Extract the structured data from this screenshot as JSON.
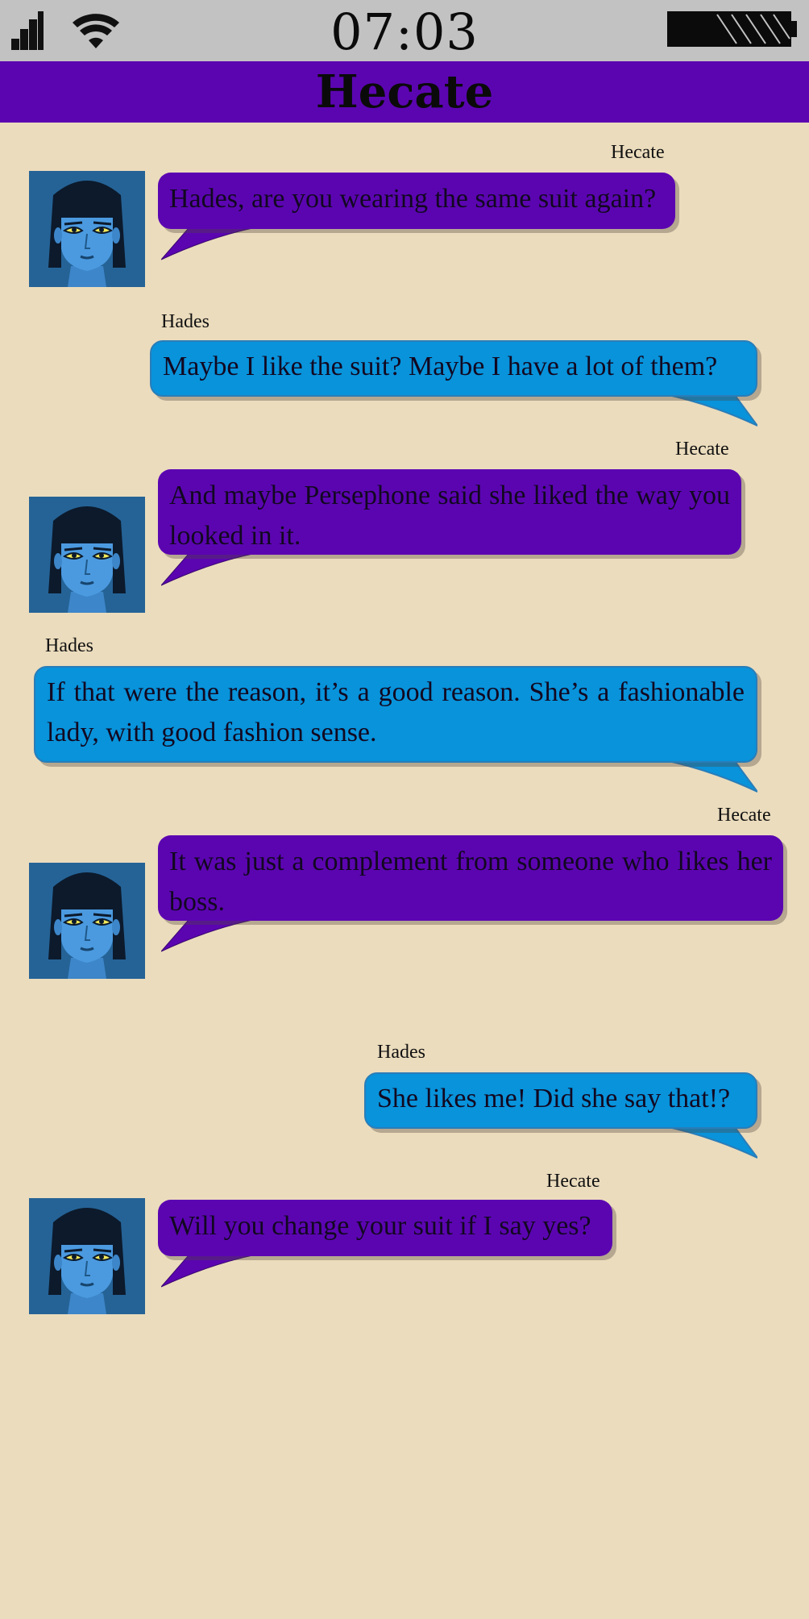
{
  "status": {
    "time": "07:03",
    "icons": [
      "signal-icon",
      "wifi-icon",
      "battery-icon"
    ]
  },
  "header": {
    "title": "Hecate"
  },
  "colors": {
    "background": "#ebdcbd",
    "status_bar": "#c2c2c2",
    "header": "#5b05b1",
    "hecate_bubble": "#5b05b1",
    "hades_bubble": "#0893db"
  },
  "messages": [
    {
      "sender": "Hecate",
      "text": "Hades, are you wearing the same suit again?"
    },
    {
      "sender": "Hades",
      "text": "Maybe I like the suit? Maybe I have a lot of them?"
    },
    {
      "sender": "Hecate",
      "text": "And maybe Persephone said she liked the way you looked in it."
    },
    {
      "sender": "Hades",
      "text": "If that were the reason, it’s a good reason. She’s a fashionable lady, with good fashion sense."
    },
    {
      "sender": "Hecate",
      "text": "It was just a complement from someone who likes her boss."
    },
    {
      "sender": "Hades",
      "text": "She likes me! Did she say that!?"
    },
    {
      "sender": "Hecate",
      "text": "Will you change your suit if I say yes?"
    }
  ]
}
